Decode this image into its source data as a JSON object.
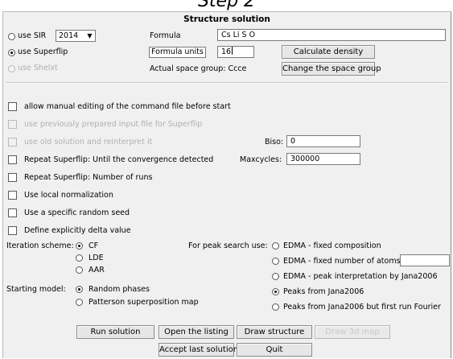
{
  "step_title": "Step 2",
  "dialog_title": "Structure solution",
  "programs": {
    "sir_label": "use SIR",
    "sir_version": "2014",
    "superflip_label": "use Superflip",
    "shelxt_label": "use Shelxt",
    "selected": "superflip"
  },
  "formula": {
    "formula_label": "Formula",
    "formula_value": "Cs Li S O",
    "units_label": "Formula units",
    "units_value": "16",
    "space_group_text": "Actual space group: Ccce",
    "calc_density_button": "Calculate density",
    "change_space_group_button": "Change the space group"
  },
  "options": {
    "manual_edit": "allow manual editing of the command file before start",
    "prev_input": "use previously prepared input file for Superflip",
    "old_solution": "use old solution and reinterpret it",
    "repeat_converge": "Repeat Superflip: Until the convergence detected",
    "repeat_runs": "Repeat Superflip: Number of runs",
    "local_norm": "Use local normalization",
    "random_seed": "Use a specific random seed",
    "delta_value": "Define explicitly delta value",
    "biso_label": "Biso:",
    "biso_value": "0",
    "maxcycles_label": "Maxcycles:",
    "maxcycles_value": "300000"
  },
  "iteration": {
    "label": "Iteration scheme:",
    "options": [
      "CF",
      "LDE",
      "AAR"
    ],
    "selected": "CF"
  },
  "peak_search": {
    "label": "For peak search use:",
    "options": [
      "EDMA - fixed composition",
      "EDMA - fixed number of atoms",
      "EDMA - peak interpretation by Jana2006",
      "Peaks from Jana2006",
      "Peaks from Jana2006 but first run Fourier"
    ],
    "selected": "Peaks from Jana2006"
  },
  "starting_model": {
    "label": "Starting model:",
    "options": [
      "Random phases",
      "Patterson superposition map"
    ],
    "selected": "Random phases"
  },
  "buttons": {
    "run_solution": "Run solution",
    "open_listing": "Open the listing",
    "draw_structure": "Draw structure",
    "draw_3d_map": "Draw 3d map",
    "accept_last": "Accept last solution",
    "quit": "Quit"
  }
}
